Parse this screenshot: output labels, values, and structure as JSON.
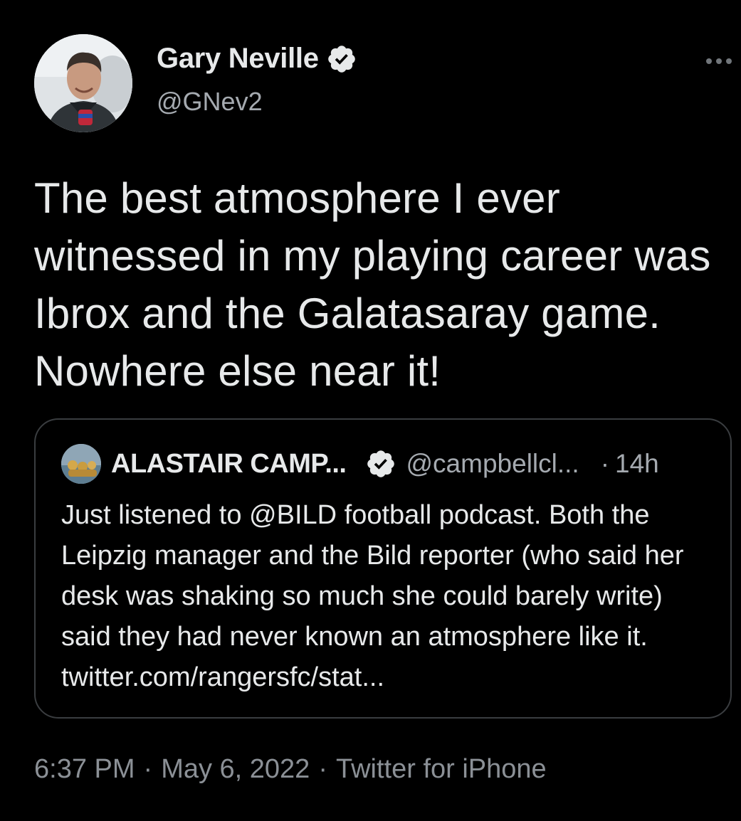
{
  "tweet": {
    "author": {
      "display_name": "Gary Neville",
      "handle": "@GNev2",
      "verified": true,
      "avatar_icon": "profile-photo"
    },
    "more_icon": "more-horizontal-icon",
    "text": "The best atmosphere I ever witnessed in my playing career was Ibrox and the Galatasaray game. Nowhere else near it!",
    "quoted": {
      "display_name": "ALASTAIR CAMP...",
      "handle": "@campbellcl...",
      "separator": "·",
      "time": "14h",
      "verified": true,
      "text": "Just listened to @BILD football podcast. Both the Leipzig manager and the Bild reporter (who said her desk was shaking so much she could barely write) said they had never known an atmosphere like it. twitter.com/rangersfc/stat..."
    },
    "meta": {
      "time": "6:37 PM",
      "date": "May 6, 2022",
      "source": "Twitter for iPhone",
      "separator": "·"
    }
  },
  "colors": {
    "background": "#000000",
    "text_primary": "#e7e9ea",
    "text_secondary": "#a5aab0",
    "border": "#3a3d40"
  }
}
